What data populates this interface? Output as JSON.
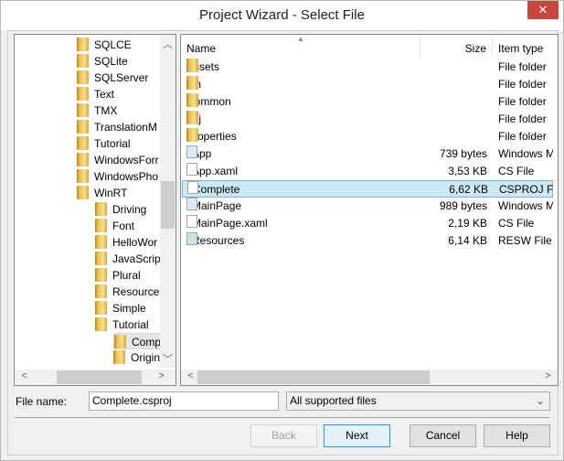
{
  "window": {
    "title": "Project Wizard - Select File",
    "close_icon": "close-icon"
  },
  "tree": {
    "items": [
      {
        "label": "SQLCE",
        "level": 0
      },
      {
        "label": "SQLite",
        "level": 0
      },
      {
        "label": "SQLServer",
        "level": 0
      },
      {
        "label": "Text",
        "level": 0
      },
      {
        "label": "TMX",
        "level": 0
      },
      {
        "label": "TranslationM",
        "level": 0
      },
      {
        "label": "Tutorial",
        "level": 0
      },
      {
        "label": "WindowsForr",
        "level": 0
      },
      {
        "label": "WindowsPho",
        "level": 0
      },
      {
        "label": "WinRT",
        "level": 0
      },
      {
        "label": "Driving",
        "level": 1
      },
      {
        "label": "Font",
        "level": 1
      },
      {
        "label": "HelloWor",
        "level": 1
      },
      {
        "label": "JavaScript",
        "level": 1
      },
      {
        "label": "Plural",
        "level": 1
      },
      {
        "label": "Resources",
        "level": 1
      },
      {
        "label": "Simple",
        "level": 1
      },
      {
        "label": "Tutorial",
        "level": 1
      },
      {
        "label": "Comp",
        "level": 2,
        "selected": true
      },
      {
        "label": "Origin",
        "level": 2
      }
    ]
  },
  "list": {
    "columns": [
      "Name",
      "Size",
      "Item type"
    ],
    "sort_column": "Name",
    "rows": [
      {
        "name": "Assets",
        "size": "",
        "type": "File folder",
        "icon": "folder"
      },
      {
        "name": "bin",
        "size": "",
        "type": "File folder",
        "icon": "folder"
      },
      {
        "name": "Common",
        "size": "",
        "type": "File folder",
        "icon": "folder"
      },
      {
        "name": "obj",
        "size": "",
        "type": "File folder",
        "icon": "folder"
      },
      {
        "name": "Properties",
        "size": "",
        "type": "File folder",
        "icon": "folder"
      },
      {
        "name": "App",
        "size": "739 bytes",
        "type": "Windows M",
        "icon": "xaml"
      },
      {
        "name": "App.xaml",
        "size": "3,53 KB",
        "type": "CS File",
        "icon": "file"
      },
      {
        "name": "Complete",
        "size": "6,62 KB",
        "type": "CSPROJ Fil",
        "icon": "csproj",
        "selected": true
      },
      {
        "name": "MainPage",
        "size": "989 bytes",
        "type": "Windows M",
        "icon": "xaml"
      },
      {
        "name": "MainPage.xaml",
        "size": "2,19 KB",
        "type": "CS File",
        "icon": "file"
      },
      {
        "name": "Resources",
        "size": "6,14 KB",
        "type": "RESW File",
        "icon": "resw"
      }
    ]
  },
  "form": {
    "file_name_label": "File name:",
    "file_name_value": "Complete.csproj",
    "filter_value": "All supported files"
  },
  "buttons": {
    "back": "Back",
    "next": "Next",
    "cancel": "Cancel",
    "help": "Help"
  }
}
